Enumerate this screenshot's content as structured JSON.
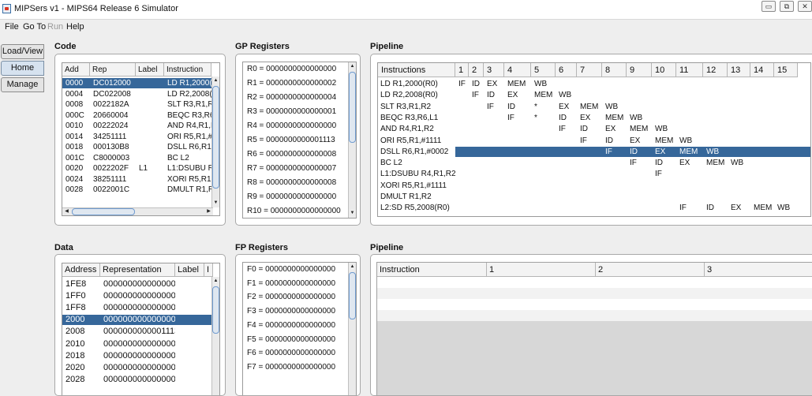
{
  "window": {
    "title": "MIPSers v1 - MIPS64 Release 6 Simulator",
    "btn_min": "▭",
    "btn_max": "⧉",
    "btn_close": "✕"
  },
  "menu": {
    "file": "File",
    "goto": "Go To",
    "run": "Run",
    "help": "Help"
  },
  "sidebar": {
    "tabs": [
      "Load/View",
      "Home",
      "Manage"
    ],
    "selected": "Home"
  },
  "code": {
    "title": "Code",
    "headers": [
      "Add",
      "Rep",
      "Label",
      "Instruction"
    ],
    "rows": [
      [
        "0000",
        "DC012000",
        "",
        "LD R1,2000("
      ],
      [
        "0004",
        "DC022008",
        "",
        "LD R2,2008("
      ],
      [
        "0008",
        "0022182A",
        "",
        "SLT R3,R1,R"
      ],
      [
        "000C",
        "20660004",
        "",
        "BEQC R3,R6"
      ],
      [
        "0010",
        "00222024",
        "",
        "AND R4,R1,R"
      ],
      [
        "0014",
        "34251111",
        "",
        "ORI R5,R1,#"
      ],
      [
        "0018",
        "000130B8",
        "",
        "DSLL R6,R1"
      ],
      [
        "001C",
        "C8000003",
        "",
        "BC L2"
      ],
      [
        "0020",
        "0022202F",
        "L1",
        "L1:DSUBU R"
      ],
      [
        "0024",
        "38251111",
        "",
        "XORI R5,R1,"
      ],
      [
        "0028",
        "0022001C",
        "",
        "DMULT R1,R"
      ]
    ],
    "selected_row": 0
  },
  "gp": {
    "title": "GP Registers",
    "regs": [
      "R0 = 0000000000000000",
      "R1 = 0000000000000002",
      "R2 = 0000000000000004",
      "R3 = 0000000000000001",
      "R4 = 0000000000000000",
      "R5 = 0000000000001113",
      "R6 = 0000000000000008",
      "R7 = 0000000000000007",
      "R8 = 0000000000000008",
      "R9 = 0000000000000000",
      "R10 = 0000000000000000"
    ]
  },
  "pipeline1": {
    "title": "Pipeline",
    "headers": [
      "Instructions",
      "1",
      "2",
      "3",
      "4",
      "5",
      "6",
      "7",
      "8",
      "9",
      "10",
      "11",
      "12",
      "13",
      "14",
      "15"
    ],
    "rows": [
      {
        "label": "LD R1,2000(R0)",
        "cells": [
          "IF",
          "ID",
          "EX",
          "MEM",
          "WB",
          "",
          "",
          "",
          "",
          "",
          "",
          "",
          "",
          "",
          ""
        ]
      },
      {
        "label": "LD R2,2008(R0)",
        "cells": [
          "",
          "IF",
          "ID",
          "EX",
          "MEM",
          "WB",
          "",
          "",
          "",
          "",
          "",
          "",
          "",
          "",
          ""
        ]
      },
      {
        "label": "SLT R3,R1,R2",
        "cells": [
          "",
          "",
          "IF",
          "ID",
          "*",
          "EX",
          "MEM",
          "WB",
          "",
          "",
          "",
          "",
          "",
          "",
          ""
        ]
      },
      {
        "label": "BEQC R3,R6,L1",
        "cells": [
          "",
          "",
          "",
          "IF",
          "*",
          "ID",
          "EX",
          "MEM",
          "WB",
          "",
          "",
          "",
          "",
          "",
          ""
        ]
      },
      {
        "label": "AND R4,R1,R2",
        "cells": [
          "",
          "",
          "",
          "",
          "",
          "IF",
          "ID",
          "EX",
          "MEM",
          "WB",
          "",
          "",
          "",
          "",
          ""
        ]
      },
      {
        "label": "ORI R5,R1,#1111",
        "cells": [
          "",
          "",
          "",
          "",
          "",
          "",
          "IF",
          "ID",
          "EX",
          "MEM",
          "WB",
          "",
          "",
          "",
          ""
        ]
      },
      {
        "label": "DSLL R6,R1,#0002",
        "cells": [
          "",
          "",
          "",
          "",
          "",
          "",
          "",
          "IF",
          "ID",
          "EX",
          "MEM",
          "WB",
          "",
          "",
          ""
        ]
      },
      {
        "label": "BC L2",
        "cells": [
          "",
          "",
          "",
          "",
          "",
          "",
          "",
          "",
          "IF",
          "ID",
          "EX",
          "MEM",
          "WB",
          "",
          ""
        ]
      },
      {
        "label": "L1:DSUBU R4,R1,R2",
        "cells": [
          "",
          "",
          "",
          "",
          "",
          "",
          "",
          "",
          "",
          "IF",
          "",
          "",
          "",
          "",
          ""
        ]
      },
      {
        "label": "XORI R5,R1,#1111",
        "cells": [
          "",
          "",
          "",
          "",
          "",
          "",
          "",
          "",
          "",
          "",
          "",
          "",
          "",
          "",
          ""
        ]
      },
      {
        "label": "DMULT R1,R2",
        "cells": [
          "",
          "",
          "",
          "",
          "",
          "",
          "",
          "",
          "",
          "",
          "",
          "",
          "",
          "",
          ""
        ]
      },
      {
        "label": "L2:SD R5,2008(R0)",
        "cells": [
          "",
          "",
          "",
          "",
          "",
          "",
          "",
          "",
          "",
          "",
          "IF",
          "ID",
          "EX",
          "MEM",
          "WB"
        ]
      }
    ],
    "selected_row": 6
  },
  "data": {
    "title": "Data",
    "headers": [
      "Address",
      "Representation",
      "Label",
      "I"
    ],
    "rows": [
      [
        "1FE8",
        "0000000000000000"
      ],
      [
        "1FF0",
        "0000000000000000"
      ],
      [
        "1FF8",
        "0000000000000000"
      ],
      [
        "2000",
        "0000000000000002"
      ],
      [
        "2008",
        "0000000000001113"
      ],
      [
        "2010",
        "0000000000000000"
      ],
      [
        "2018",
        "0000000000000000"
      ],
      [
        "2020",
        "0000000000000000"
      ],
      [
        "2028",
        "0000000000000000"
      ]
    ],
    "selected_row": 3
  },
  "fp": {
    "title": "FP Registers",
    "regs": [
      "F0 = 0000000000000000",
      "F1 = 0000000000000000",
      "F2 = 0000000000000000",
      "F3 = 0000000000000000",
      "F4 = 0000000000000000",
      "F5 = 0000000000000000",
      "F6 = 0000000000000000",
      "F7 = 0000000000000000"
    ]
  },
  "pipeline2": {
    "title": "Pipeline",
    "headers": [
      "Instruction",
      "1",
      "2",
      "3"
    ]
  },
  "colors": {
    "selection": "#36679a",
    "scroll_thumb_border": "#6f9bd0"
  }
}
